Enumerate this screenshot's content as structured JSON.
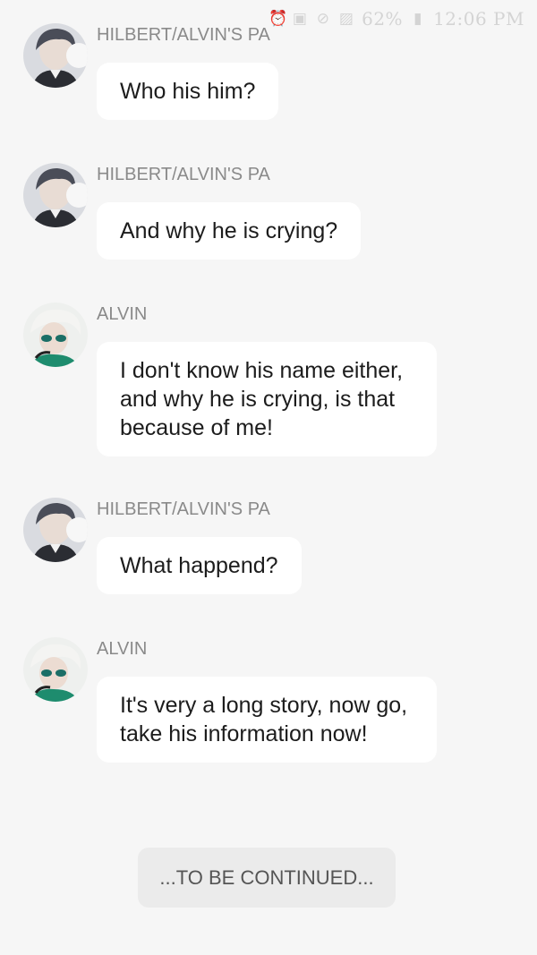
{
  "status_bar": {
    "icons": [
      "alarm-icon",
      "sim-icon",
      "mute-icon",
      "image-icon"
    ],
    "battery": "62%",
    "time": "12:06 PM"
  },
  "messages": [
    {
      "sender": "HILBERT/ALVIN'S PA",
      "text": "Who his him?",
      "avatar": "hilbert-avatar"
    },
    {
      "sender": "HILBERT/ALVIN'S PA",
      "text": "And why he is crying?",
      "avatar": "hilbert-avatar"
    },
    {
      "sender": "ALVIN",
      "text": "I don't know his name either, and why he is crying, is that because of me!",
      "avatar": "alvin-avatar"
    },
    {
      "sender": "HILBERT/ALVIN'S PA",
      "text": "What happend?",
      "avatar": "hilbert-avatar"
    },
    {
      "sender": "ALVIN",
      "text": "It's very a long story, now go, take his information now!",
      "avatar": "alvin-avatar"
    }
  ],
  "footer": {
    "continue_label": "...TO BE CONTINUED..."
  },
  "colors": {
    "background": "#f6f6f6",
    "bubble": "#ffffff",
    "sender_text": "#8a8a8a",
    "message_text": "#1c1c1c",
    "continue_bg": "#ebebeb"
  }
}
